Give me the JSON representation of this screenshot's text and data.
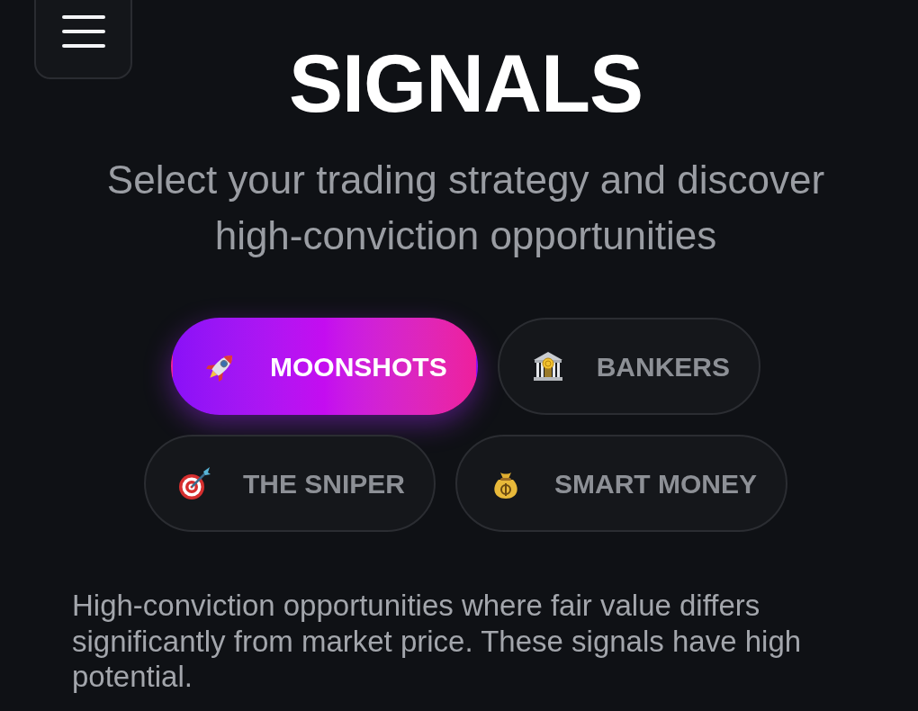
{
  "title": "SIGNALS",
  "subtitle": "Select your trading strategy and discover high-conviction opportunities",
  "strategies": [
    {
      "label": "MOONSHOTS",
      "kind": "rocket",
      "selected": true
    },
    {
      "label": "BANKERS",
      "kind": "bank",
      "selected": false
    },
    {
      "label": "THE SNIPER",
      "kind": "target",
      "selected": false
    },
    {
      "label": "SMART MONEY",
      "kind": "moneybag",
      "selected": false
    }
  ],
  "description": "High-conviction opportunities where fair value differs significantly from market price. These signals have high potential."
}
